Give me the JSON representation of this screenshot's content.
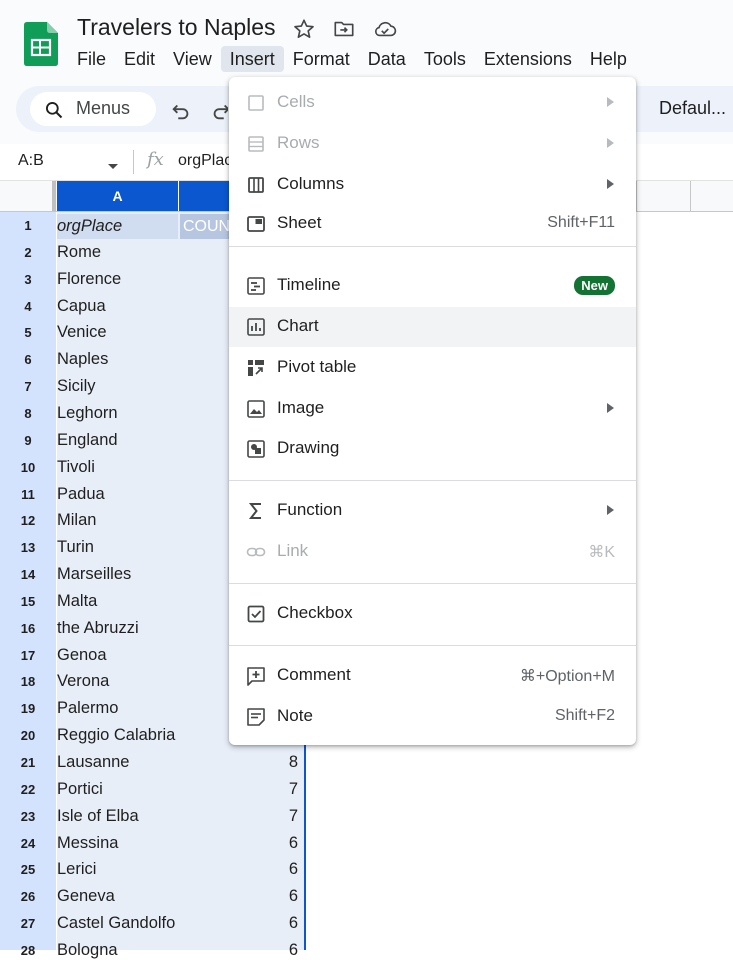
{
  "app": {
    "doc_title": "Travelers to Naples",
    "menubar": [
      "File",
      "Edit",
      "View",
      "Insert",
      "Format",
      "Data",
      "Tools",
      "Extensions",
      "Help"
    ],
    "active_menu": "Insert"
  },
  "toolbar": {
    "search_label": "Menus",
    "font_name": "Defaul..."
  },
  "formula_bar": {
    "name_box": "A:B",
    "fx_label": "fx",
    "content": "orgPlac"
  },
  "grid": {
    "col_a_header": "A",
    "b1_value": "COUN",
    "rows": [
      {
        "num": "1",
        "place": "orgPlace",
        "count": ""
      },
      {
        "num": "2",
        "place": "Rome",
        "count": ""
      },
      {
        "num": "3",
        "place": "Florence",
        "count": ""
      },
      {
        "num": "4",
        "place": "Capua",
        "count": ""
      },
      {
        "num": "5",
        "place": "Venice",
        "count": ""
      },
      {
        "num": "6",
        "place": "Naples",
        "count": ""
      },
      {
        "num": "7",
        "place": "Sicily",
        "count": ""
      },
      {
        "num": "8",
        "place": "Leghorn",
        "count": ""
      },
      {
        "num": "9",
        "place": "England",
        "count": ""
      },
      {
        "num": "10",
        "place": "Tivoli",
        "count": ""
      },
      {
        "num": "11",
        "place": "Padua",
        "count": ""
      },
      {
        "num": "12",
        "place": "Milan",
        "count": ""
      },
      {
        "num": "13",
        "place": "Turin",
        "count": ""
      },
      {
        "num": "14",
        "place": "Marseilles",
        "count": ""
      },
      {
        "num": "15",
        "place": "Malta",
        "count": ""
      },
      {
        "num": "16",
        "place": "the Abruzzi",
        "count": ""
      },
      {
        "num": "17",
        "place": "Genoa",
        "count": ""
      },
      {
        "num": "18",
        "place": "Verona",
        "count": ""
      },
      {
        "num": "19",
        "place": "Palermo",
        "count": ""
      },
      {
        "num": "20",
        "place": "Reggio Calabria",
        "count": ""
      },
      {
        "num": "21",
        "place": "Lausanne",
        "count": "8"
      },
      {
        "num": "22",
        "place": "Portici",
        "count": "7"
      },
      {
        "num": "23",
        "place": "Isle of Elba",
        "count": "7"
      },
      {
        "num": "24",
        "place": "Messina",
        "count": "6"
      },
      {
        "num": "25",
        "place": "Lerici",
        "count": "6"
      },
      {
        "num": "26",
        "place": "Geneva",
        "count": "6"
      },
      {
        "num": "27",
        "place": "Castel Gandolfo",
        "count": "6"
      },
      {
        "num": "28",
        "place": "Bologna",
        "count": "6"
      }
    ]
  },
  "insert_menu": {
    "items": [
      {
        "label": "Cells",
        "shortcut": "",
        "submenu": true,
        "disabled": true,
        "icon": "cells-icon"
      },
      {
        "label": "Rows",
        "shortcut": "",
        "submenu": true,
        "disabled": true,
        "icon": "rows-icon"
      },
      {
        "label": "Columns",
        "shortcut": "",
        "submenu": true,
        "disabled": false,
        "icon": "columns-icon"
      },
      {
        "label": "Sheet",
        "shortcut": "Shift+F11",
        "submenu": false,
        "disabled": false,
        "icon": "sheet-icon"
      },
      {
        "label": "Timeline",
        "shortcut": "",
        "badge": "New",
        "submenu": false,
        "disabled": false,
        "icon": "timeline-icon"
      },
      {
        "label": "Chart",
        "shortcut": "",
        "submenu": false,
        "disabled": false,
        "icon": "chart-icon",
        "hover": true
      },
      {
        "label": "Pivot table",
        "shortcut": "",
        "submenu": false,
        "disabled": false,
        "icon": "pivot-table-icon"
      },
      {
        "label": "Image",
        "shortcut": "",
        "submenu": true,
        "disabled": false,
        "icon": "image-icon"
      },
      {
        "label": "Drawing",
        "shortcut": "",
        "submenu": false,
        "disabled": false,
        "icon": "drawing-icon"
      },
      {
        "label": "Function",
        "shortcut": "",
        "submenu": true,
        "disabled": false,
        "icon": "function-icon"
      },
      {
        "label": "Link",
        "shortcut": "⌘K",
        "submenu": false,
        "disabled": true,
        "icon": "link-icon"
      },
      {
        "label": "Checkbox",
        "shortcut": "",
        "submenu": false,
        "disabled": false,
        "icon": "checkbox-icon"
      },
      {
        "label": "Comment",
        "shortcut": "⌘+Option+M",
        "submenu": false,
        "disabled": false,
        "icon": "comment-icon"
      },
      {
        "label": "Note",
        "shortcut": "Shift+F2",
        "submenu": false,
        "disabled": false,
        "icon": "note-icon"
      }
    ]
  },
  "colors": {
    "accent_blue": "#0b57d0",
    "header_bg": "#f9fbfd",
    "toolbar_bg": "#edf2fa",
    "new_badge": "#137333",
    "sheets_green": "#0f9d58"
  }
}
